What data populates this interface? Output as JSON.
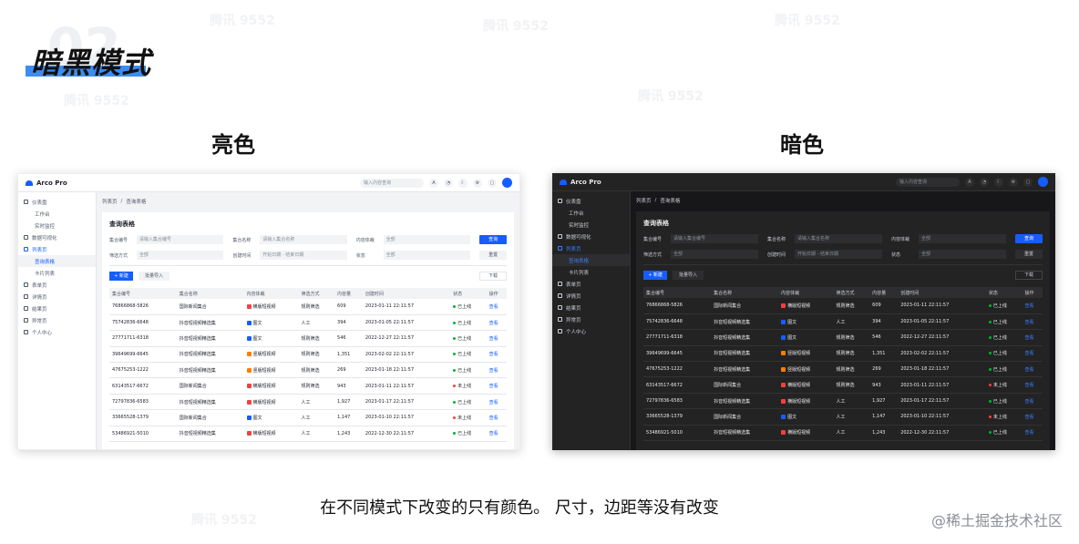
{
  "page": {
    "title_num": "02",
    "title": "暗黑模式",
    "light_label": "亮色",
    "dark_label": "暗色",
    "caption": "在不同模式下改变的只有颜色。 尺寸，边距等没有改变",
    "credit": "@稀土掘金技术社区",
    "watermark": "腾讯 9552"
  },
  "app": {
    "brand": "Arco Pro",
    "search_placeholder": "输入内容查询",
    "menu": [
      {
        "label": "仪表盘",
        "level": 0,
        "state": "normal"
      },
      {
        "label": "工作台",
        "level": 1,
        "state": "normal"
      },
      {
        "label": "实时监控",
        "level": 1,
        "state": "normal"
      },
      {
        "label": "数据可视化",
        "level": 0,
        "state": "normal"
      },
      {
        "label": "列表页",
        "level": 0,
        "state": "open"
      },
      {
        "label": "查询表格",
        "level": 1,
        "state": "active"
      },
      {
        "label": "卡片列表",
        "level": 1,
        "state": "normal"
      },
      {
        "label": "表单页",
        "level": 0,
        "state": "normal"
      },
      {
        "label": "详情页",
        "level": 0,
        "state": "normal"
      },
      {
        "label": "结果页",
        "level": 0,
        "state": "normal"
      },
      {
        "label": "异常页",
        "level": 0,
        "state": "normal"
      },
      {
        "label": "个人中心",
        "level": 0,
        "state": "normal"
      }
    ],
    "breadcrumb": [
      "列表页",
      "查询表格"
    ],
    "card_title": "查询表格",
    "filters": {
      "id_label": "集合编号",
      "id_placeholder": "请输入集合编号",
      "name_label": "集合名称",
      "name_placeholder": "请输入集合名称",
      "type_label": "内容体裁",
      "type_value": "全部",
      "method_label": "筛选方式",
      "method_value": "全部",
      "time_label": "创建时间",
      "time_value": "开始日期 - 结束日期",
      "status_label": "状态",
      "status_value": "全部"
    },
    "buttons": {
      "query": "查询",
      "reset": "重置",
      "new": "+ 新建",
      "import": "批量导入",
      "download": "下载"
    },
    "columns": [
      "集合编号",
      "集合名称",
      "内容体裁",
      "筛选方式",
      "内容量",
      "创建时间",
      "状态",
      "操作"
    ],
    "rows": [
      [
        "76866868-5826",
        "国际新闻集合",
        "横版短视频",
        "规则筛选",
        "609",
        "2023-01-11 22:11:57",
        "已上线",
        "查看"
      ],
      [
        "75742836-6648",
        "抖音短视频精选集",
        "图文",
        "人工",
        "394",
        "2023-01-05 22:11:57",
        "已上线",
        "查看"
      ],
      [
        "27771711-6318",
        "抖音短视频精选集",
        "图文",
        "规则筛选",
        "546",
        "2022-12-27 22:11:57",
        "已上线",
        "查看"
      ],
      [
        "39649699-6645",
        "抖音短视频精选集",
        "竖版短视频",
        "规则筛选",
        "1,351",
        "2023-02-02 22:11:57",
        "已上线",
        "查看"
      ],
      [
        "47675253-1222",
        "抖音短视频精选集",
        "竖版短视频",
        "规则筛选",
        "269",
        "2023-01-18 22:11:57",
        "已上线",
        "查看"
      ],
      [
        "63143517-6672",
        "国际新闻集合",
        "横版短视频",
        "规则筛选",
        "943",
        "2023-01-11 22:11:57",
        "未上线",
        "查看"
      ],
      [
        "72797836-6583",
        "抖音短视频精选集",
        "横版短视频",
        "人工",
        "1,927",
        "2023-01-17 22:11:57",
        "已上线",
        "查看"
      ],
      [
        "33665528-1379",
        "国际新闻集合",
        "图文",
        "人工",
        "1,147",
        "2023-01-10 22:11:57",
        "未上线",
        "查看"
      ],
      [
        "53486921-5010",
        "抖音短视频精选集",
        "横版短视频",
        "人工",
        "1,243",
        "2022-12-30 22:11:57",
        "已上线",
        "查看"
      ]
    ],
    "colors": {
      "primary": "#165dff",
      "online": "#00b42a",
      "offline": "#f53f3f"
    }
  }
}
